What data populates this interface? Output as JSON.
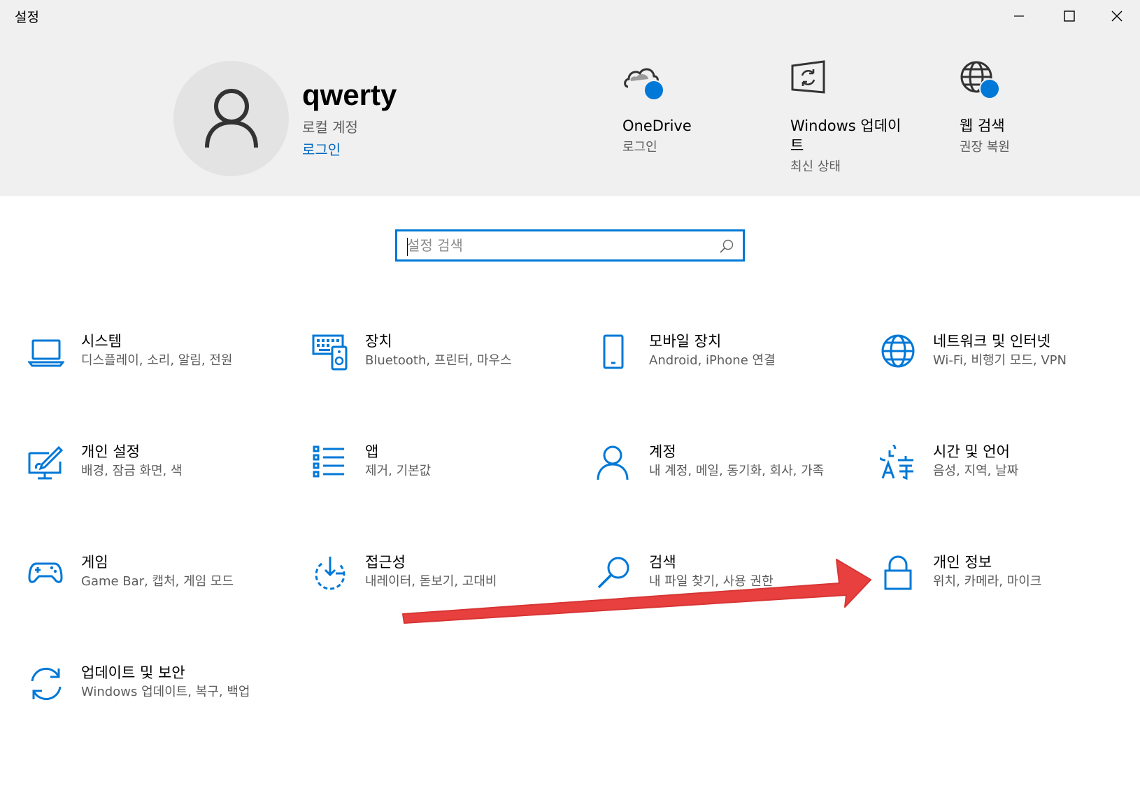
{
  "window": {
    "title": "설정"
  },
  "account": {
    "name": "qwerty",
    "type": "로컬 계정",
    "link": "로그인"
  },
  "quick_links": [
    {
      "title": "OneDrive",
      "subtitle": "로그인",
      "icon": "onedrive-cloud-icon"
    },
    {
      "title": "Windows 업데이\n트",
      "subtitle": "최신 상태",
      "icon": "windows-update-icon"
    },
    {
      "title": "웹 검색",
      "subtitle": "권장 복원",
      "icon": "web-globe-icon"
    }
  ],
  "search": {
    "placeholder": "설정 검색"
  },
  "categories": [
    {
      "title": "시스템",
      "subtitle": "디스플레이, 소리, 알림, 전원",
      "icon": "laptop-icon"
    },
    {
      "title": "장치",
      "subtitle": "Bluetooth, 프린터, 마우스",
      "icon": "keyboard-speaker-icon"
    },
    {
      "title": "모바일 장치",
      "subtitle": "Android, iPhone 연결",
      "icon": "phone-icon"
    },
    {
      "title": "네트워크 및 인터넷",
      "subtitle": "Wi-Fi, 비행기 모드, VPN",
      "icon": "globe-icon"
    },
    {
      "title": "개인 설정",
      "subtitle": "배경, 잠금 화면, 색",
      "icon": "paint-display-icon"
    },
    {
      "title": "앱",
      "subtitle": "제거, 기본값",
      "icon": "app-list-icon"
    },
    {
      "title": "계정",
      "subtitle": "내 계정, 메일, 동기화, 회사, 가족",
      "icon": "person-icon"
    },
    {
      "title": "시간 및 언어",
      "subtitle": "음성, 지역, 날짜",
      "icon": "time-language-icon"
    },
    {
      "title": "게임",
      "subtitle": "Game Bar, 캡처, 게임 모드",
      "icon": "gamepad-icon"
    },
    {
      "title": "접근성",
      "subtitle": "내레이터, 돋보기, 고대비",
      "icon": "ease-of-access-icon"
    },
    {
      "title": "검색",
      "subtitle": "내 파일 찾기, 사용 권한",
      "icon": "search-magnifier-icon"
    },
    {
      "title": "개인 정보",
      "subtitle": "위치, 카메라, 마이크",
      "icon": "lock-icon"
    },
    {
      "title": "업데이트 및 보안",
      "subtitle": "Windows 업데이트, 복구, 백업",
      "icon": "sync-icon"
    }
  ],
  "colors": {
    "accent": "#0078d7",
    "header_bg": "#f0f0f0",
    "annotation_arrow": "#e8403f"
  }
}
